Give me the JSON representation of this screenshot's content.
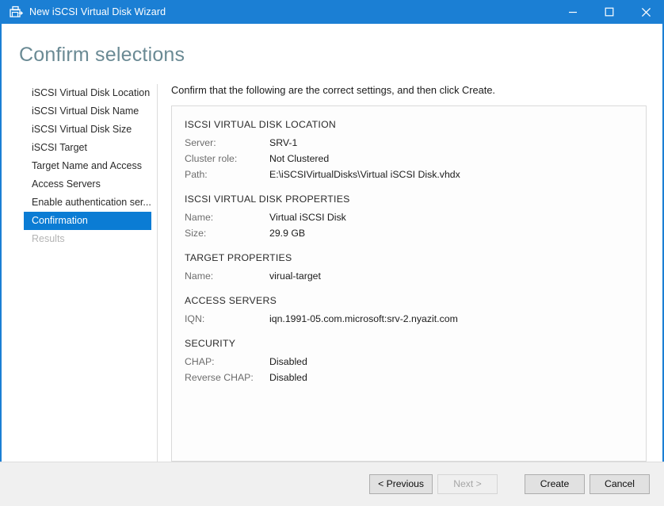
{
  "window": {
    "title": "New iSCSI Virtual Disk Wizard",
    "icon": "disk-wizard-icon",
    "minimize_label": "Minimize",
    "maximize_label": "Maximize",
    "close_label": "Close",
    "accent_color": "#1b7fd4"
  },
  "page": {
    "heading": "Confirm selections",
    "heading_color": "#6a8a94"
  },
  "sidebar": {
    "items": [
      {
        "label": "iSCSI Virtual Disk Location",
        "state": "normal"
      },
      {
        "label": "iSCSI Virtual Disk Name",
        "state": "normal"
      },
      {
        "label": "iSCSI Virtual Disk Size",
        "state": "normal"
      },
      {
        "label": "iSCSI Target",
        "state": "normal"
      },
      {
        "label": "Target Name and Access",
        "state": "normal"
      },
      {
        "label": "Access Servers",
        "state": "normal"
      },
      {
        "label": "Enable authentication ser...",
        "state": "normal"
      },
      {
        "label": "Confirmation",
        "state": "selected"
      },
      {
        "label": "Results",
        "state": "disabled"
      }
    ],
    "selected_color": "#0b7cd4"
  },
  "content": {
    "intro": "Confirm that the following are the correct settings, and then click Create.",
    "groups": [
      {
        "title": "ISCSI VIRTUAL DISK LOCATION",
        "rows": [
          {
            "label": "Server:",
            "value": "SRV-1"
          },
          {
            "label": "Cluster role:",
            "value": "Not Clustered"
          },
          {
            "label": "Path:",
            "value": "E:\\iSCSIVirtualDisks\\Virtual iSCSI Disk.vhdx"
          }
        ]
      },
      {
        "title": "ISCSI VIRTUAL DISK PROPERTIES",
        "rows": [
          {
            "label": "Name:",
            "value": "Virtual iSCSI Disk"
          },
          {
            "label": "Size:",
            "value": "29.9 GB"
          }
        ]
      },
      {
        "title": "TARGET PROPERTIES",
        "rows": [
          {
            "label": "Name:",
            "value": "virual-target"
          }
        ]
      },
      {
        "title": "ACCESS SERVERS",
        "rows": [
          {
            "label": "IQN:",
            "value": "iqn.1991-05.com.microsoft:srv-2.nyazit.com"
          }
        ]
      },
      {
        "title": "SECURITY",
        "rows": [
          {
            "label": "CHAP:",
            "value": "Disabled"
          },
          {
            "label": "Reverse CHAP:",
            "value": "Disabled"
          }
        ]
      }
    ]
  },
  "footer": {
    "previous_label": "< Previous",
    "next_label": "Next >",
    "next_disabled": true,
    "create_label": "Create",
    "cancel_label": "Cancel"
  }
}
